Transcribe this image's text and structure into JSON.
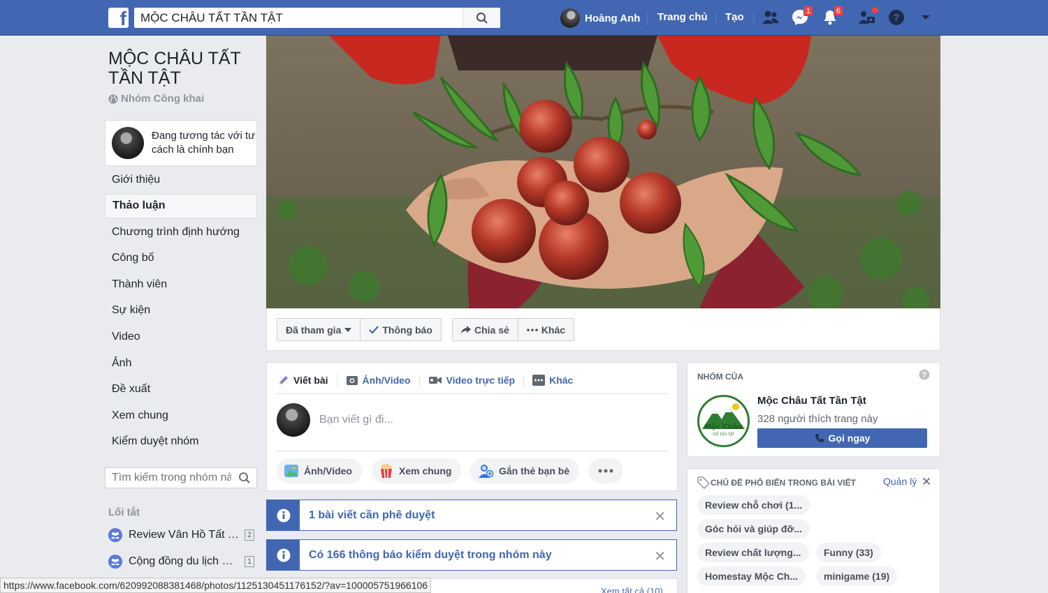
{
  "topbar": {
    "search_value": "MỘC CHÂU TẤT TẦN TẬT",
    "user_name": "Hoàng Anh",
    "home_label": "Trang chủ",
    "create_label": "Tạo",
    "messenger_badge": "1",
    "notifications_badge": "6",
    "brand_color": "#4267b2"
  },
  "group": {
    "title": "MỘC CHÂU TẤT TẦN TẬT",
    "privacy": "Nhóm Công khai",
    "acting_as": "Đang tương tác với tư cách là chính bạn"
  },
  "nav": {
    "items": [
      "Giới thiệu",
      "Thảo luận",
      "Chương trình định hướng",
      "Công bố",
      "Thành viên",
      "Sự kiện",
      "Video",
      "Ảnh",
      "Đề xuất",
      "Xem chung",
      "Kiểm duyệt nhóm"
    ],
    "active": "Thảo luận"
  },
  "group_search": {
    "placeholder": "Tìm kiếm trong nhóm này"
  },
  "shortcuts": {
    "heading": "Lối tắt",
    "items": [
      {
        "label": "Review Vân Hồ Tất Tần Tật",
        "count": "2"
      },
      {
        "label": "Cộng đồng du lịch Mộc Châu",
        "count": "1"
      }
    ]
  },
  "actions": {
    "joined": "Đã tham gia",
    "notifications": "Thông báo",
    "share": "Chia sẻ",
    "more": "Khác"
  },
  "composer": {
    "tabs": [
      "Viết bài",
      "Ảnh/Video",
      "Video trực tiếp",
      "Khác"
    ],
    "placeholder": "Bạn viết gì đi...",
    "pills": [
      "Ảnh/Video",
      "Xem chung",
      "Gắn thẻ bạn bè"
    ]
  },
  "notices": [
    {
      "text": "1 bài viết cần phê duyệt"
    },
    {
      "text": "Có 166 thông báo kiểm duyệt trong nhóm này"
    }
  ],
  "see_all": "Xem tất cả (10)",
  "owner_card": {
    "heading": "NHÓM CỦA",
    "page_name": "Mộc Châu Tất Tần Tật",
    "likes": "328 người thích trang này",
    "call_label": "Gọi ngay",
    "logo_text": "Mộc Châu",
    "logo_sub": "tất tần tật"
  },
  "topics_card": {
    "heading": "CHỦ ĐỀ PHỔ BIẾN TRONG BÀI VIẾT",
    "manage": "Quản lý",
    "topics": [
      "Review chỗ chơi (1...",
      "Góc hỏi và giúp đỡ...",
      "Review chất lượng...",
      "Funny (33)",
      "Homestay Mộc Ch...",
      "minigame (19)"
    ]
  },
  "status_url": "https://www.facebook.com/620992088381468/photos/1125130451176152/?av=100005751966106"
}
